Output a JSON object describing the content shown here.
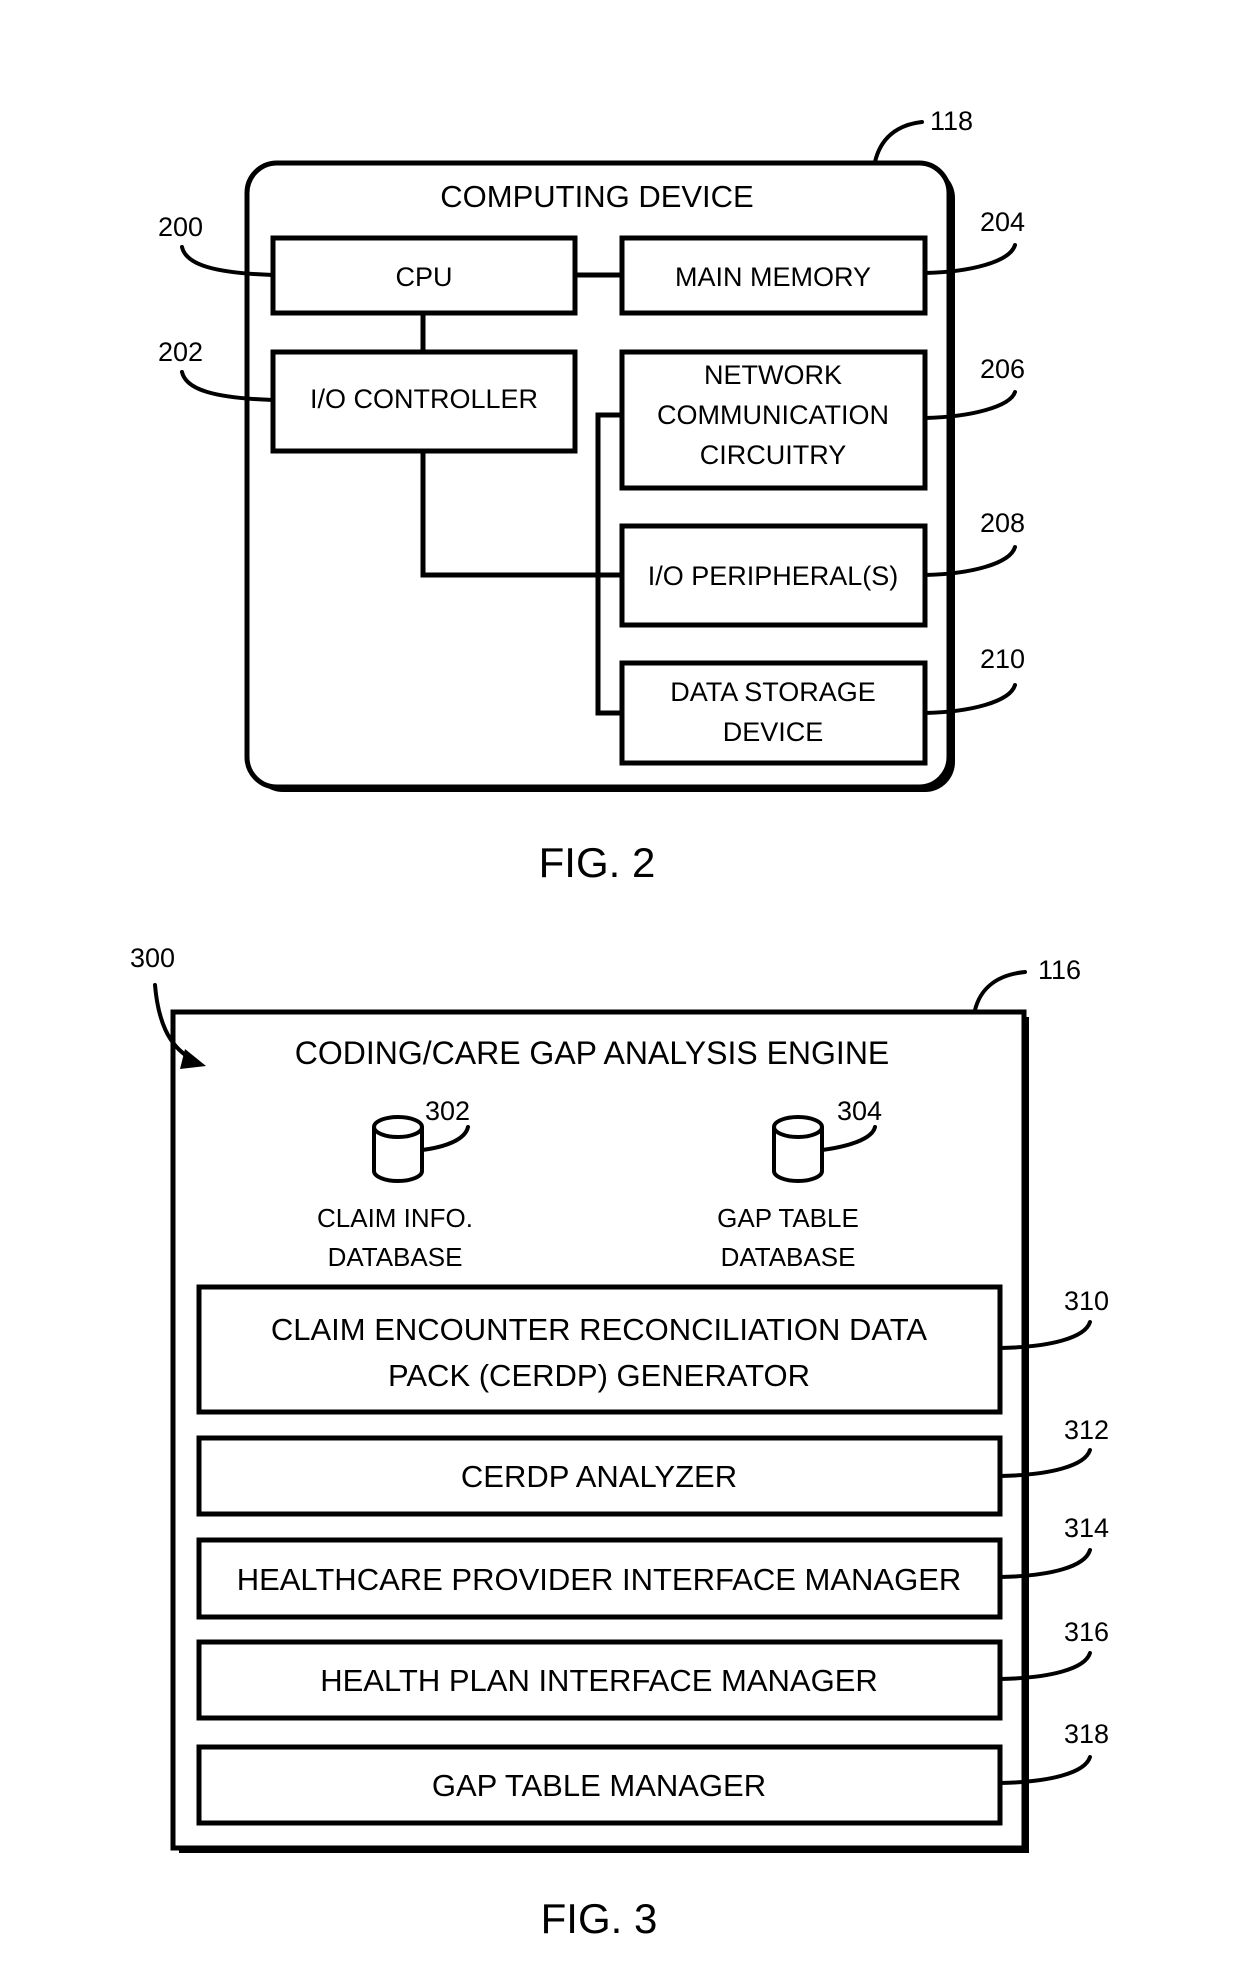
{
  "fig2": {
    "caption": "FIG. 2",
    "device": {
      "title": "COMPUTING DEVICE",
      "ref": "118"
    },
    "components": [
      {
        "id": "cpu",
        "ref": "200",
        "lines": [
          "CPU"
        ]
      },
      {
        "id": "io-controller",
        "ref": "202",
        "lines": [
          "I/O CONTROLLER"
        ]
      },
      {
        "id": "main-memory",
        "ref": "204",
        "lines": [
          "MAIN MEMORY"
        ]
      },
      {
        "id": "network-communication-circuitry",
        "ref": "206",
        "lines": [
          "NETWORK",
          "COMMUNICATION",
          "CIRCUITRY"
        ]
      },
      {
        "id": "io-peripherals",
        "ref": "208",
        "lines": [
          "I/O PERIPHERAL(S)"
        ]
      },
      {
        "id": "data-storage-device",
        "ref": "210",
        "lines": [
          "DATA STORAGE",
          "DEVICE"
        ]
      }
    ],
    "connections": [
      [
        "cpu",
        "main-memory"
      ],
      [
        "cpu",
        "io-controller"
      ],
      [
        "io-controller",
        "network-communication-circuitry"
      ],
      [
        "io-controller",
        "io-peripherals"
      ],
      [
        "io-controller",
        "data-storage-device"
      ]
    ]
  },
  "fig3": {
    "caption": "FIG. 3",
    "environment_ref": "300",
    "engine": {
      "title": "CODING/CARE GAP ANALYSIS ENGINE",
      "ref": "116"
    },
    "databases": [
      {
        "id": "claim-info-database",
        "ref": "302",
        "lines": [
          "CLAIM INFO.",
          "DATABASE"
        ]
      },
      {
        "id": "gap-table-database",
        "ref": "304",
        "lines": [
          "GAP TABLE",
          "DATABASE"
        ]
      }
    ],
    "modules": [
      {
        "id": "cerdp-generator",
        "ref": "310",
        "lines": [
          "CLAIM ENCOUNTER RECONCILIATION DATA",
          "PACK (CERDP) GENERATOR"
        ]
      },
      {
        "id": "cerdp-analyzer",
        "ref": "312",
        "lines": [
          "CERDP ANALYZER"
        ]
      },
      {
        "id": "healthcare-provider-interface-manager",
        "ref": "314",
        "lines": [
          "HEALTHCARE PROVIDER INTERFACE MANAGER"
        ]
      },
      {
        "id": "health-plan-interface-manager",
        "ref": "316",
        "lines": [
          "HEALTH PLAN INTERFACE MANAGER"
        ]
      },
      {
        "id": "gap-table-manager",
        "ref": "318",
        "lines": [
          "GAP TABLE MANAGER"
        ]
      }
    ]
  }
}
